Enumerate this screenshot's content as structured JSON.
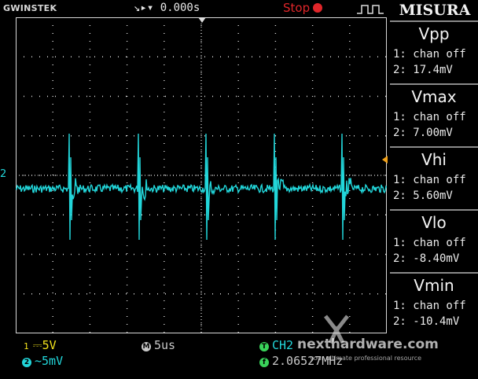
{
  "header": {
    "brand": "GWINSTEK",
    "trigger_readout": "↘▸▾ 0.000s",
    "run_state": "Stop",
    "measure_title": "MISURA"
  },
  "measurements": [
    {
      "name": "Vpp",
      "ch1": "1: chan off",
      "ch2": "2: 17.4mV"
    },
    {
      "name": "Vmax",
      "ch1": "1: chan off",
      "ch2": "2: 7.00mV"
    },
    {
      "name": "Vhi",
      "ch1": "1: chan off",
      "ch2": "2: 5.60mV"
    },
    {
      "name": "Vlo",
      "ch1": "1: chan off",
      "ch2": "2: -8.40mV"
    },
    {
      "name": "Vmin",
      "ch1": "1: chan off",
      "ch2": "2: -10.4mV"
    }
  ],
  "status": {
    "ch1_num": "1",
    "ch1_scale": "⎓5V",
    "ch2_num": "2",
    "ch2_scale": "~5mV",
    "timebase_badge": "M",
    "timebase": "5us",
    "trigger_badge": "T",
    "trigger_source": "CH2",
    "freq_badge": "f",
    "frequency": "2.06527MHz"
  },
  "markers": {
    "ch2_level": "2"
  },
  "watermark": {
    "site": "nexthardware.com",
    "tagline": "your ultimate professional resource"
  },
  "colors": {
    "trace": "#22d6da",
    "grid": "#d8d8d8",
    "ch1": "#f2e21c",
    "stop": "#e0262a"
  },
  "icons": [
    "trigger-mode-icon",
    "stop-indicator-icon",
    "trigger-edge-icon",
    "trigger-marker-icon",
    "ground-level-marker-icon"
  ]
}
